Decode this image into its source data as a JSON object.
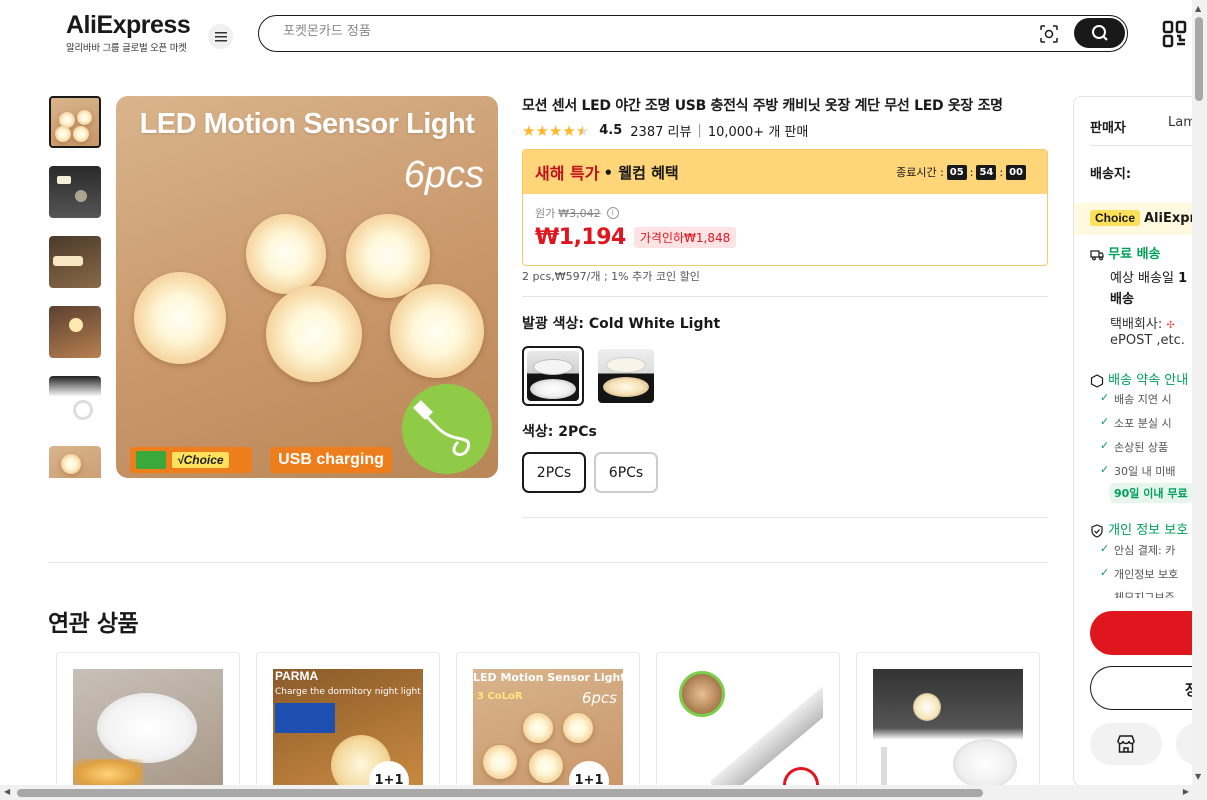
{
  "header": {
    "logo": "AliExpress",
    "logo_sub": "알리바바 그룹 글로벌 오픈 마켓",
    "search_placeholder": "포켓몬카드 정품"
  },
  "gallery": {
    "main_title": "LED Motion Sensor Light",
    "main_pcs": "6pcs",
    "badge_choice": "√Choice",
    "badge_usb": "USB charging"
  },
  "product": {
    "title": "모션 센서 LED 야간 조명 USB 충전식 주방 캐비닛 옷장 계단 무선 LED 옷장 조명",
    "stars": 4.5,
    "rating": "4.5",
    "reviews": "2387 리뷰",
    "sold": "10,000+ 개 판매"
  },
  "deal": {
    "title": "새해 특가",
    "subtitle": "• 웰컴 혜택",
    "timer_label": "종료시간 :",
    "hours": "05",
    "minutes": "54",
    "seconds": "00",
    "orig_label": "원가",
    "orig_price": "₩3,042",
    "price": "₩1,194",
    "discount": "가격인하₩1,848",
    "per_unit": "2 pcs,₩597/개 ; 1% 추가 코인 할인"
  },
  "options": {
    "light_label": "발광 색상:",
    "light_value": "Cold White Light",
    "color_label": "색상:",
    "color_value": "2PCs",
    "chips": [
      "2PCs",
      "6PCs"
    ]
  },
  "related": {
    "title": "연관 상품",
    "card2_brand": "PARMA",
    "card2_line": "Charge the dormitory night light",
    "card3_title": "LED Motion Sensor Light",
    "card3_pcs": "6pcs",
    "card3_color": "3 CoLoR",
    "badge": "1+1"
  },
  "panel": {
    "seller_label": "판매자",
    "seller_value": "Lam",
    "ship_to": "배송지:",
    "choice_tag": "Choice",
    "choice_name": "AliExpr",
    "free_ship": "무료 배송",
    "eta": "예상 배송일",
    "eta_bold": "1",
    "eta2": "배송",
    "courier": "택배회사:",
    "courier2": "ePOST ,etc.",
    "promise": "배송 약속 안내",
    "checks": [
      "배송 지연 시",
      "소포 분실 시",
      "손상된 상품",
      "30일 내 미배"
    ],
    "green_tag": "90일 이내 무료",
    "privacy": "개인 정보 보호",
    "privacy_checks": [
      "안심 결제: 카",
      "개인정보 보호",
      "체모지그보주"
    ],
    "cart_label": "장"
  }
}
